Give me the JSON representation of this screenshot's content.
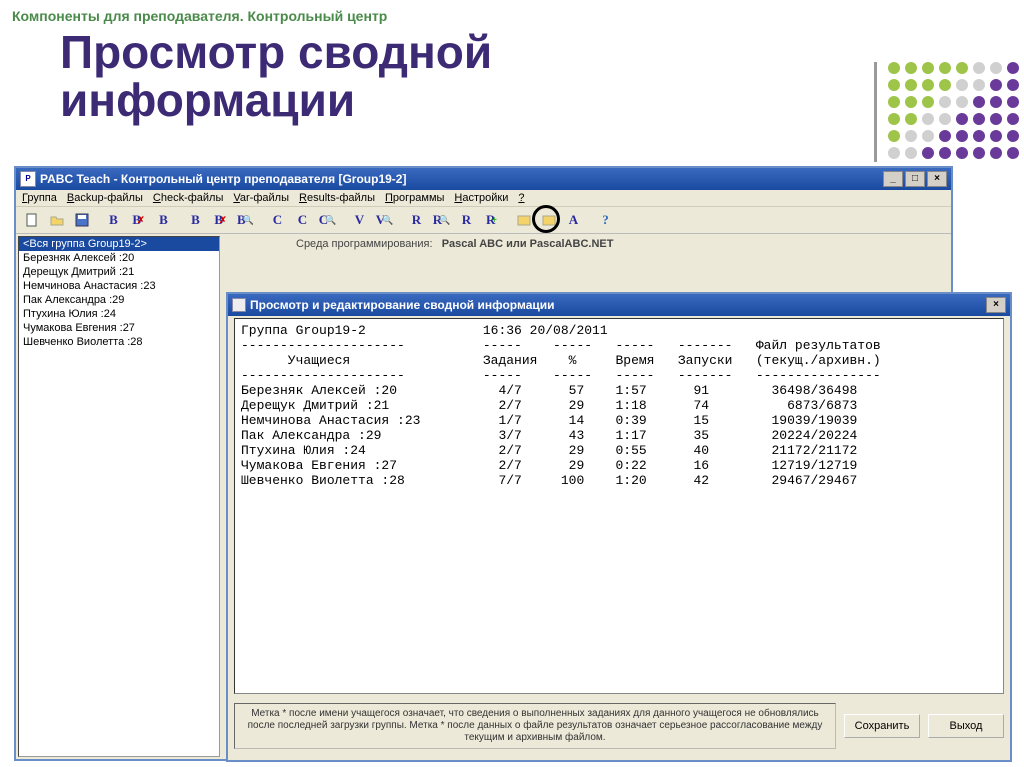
{
  "slide": {
    "breadcrumb": "Компоненты для преподавателя. Контрольный центр",
    "title_line1": "Просмотр сводной",
    "title_line2": "информации"
  },
  "mainWindow": {
    "title": "PABC Teach - Контрольный центр преподавателя [Group19-2]",
    "menu": [
      "Группа",
      "Backup-файлы",
      "Check-файлы",
      "Var-файлы",
      "Results-файлы",
      "Программы",
      "Настройки",
      "?"
    ],
    "toolbarIcons": [
      "new",
      "open",
      "save",
      "sep",
      "b-open",
      "b-export",
      "b-refresh",
      "sep",
      "B",
      "Bx",
      "Bsearch",
      "sep",
      "C",
      "Cc",
      "Csearch",
      "sep",
      "V",
      "Vsearch",
      "sep",
      "R",
      "Rsearch",
      "Rp",
      "Rplus",
      "sep",
      "g1",
      "g2",
      "A",
      "sep",
      "help"
    ],
    "envLabel": "Среда программирования:",
    "envValue": "Pascal ABC или PascalABC.NET",
    "sidebar": {
      "selected": "<Вся группа Group19-2>",
      "items": [
        "Березняк Алексей :20",
        "Дерещук Дмитрий :21",
        "Немчинова Анастасия :23",
        "Пак Александра :29",
        "Птухина Юлия :24",
        "Чумакова Евгения :27",
        "Шевченко Виолетта :28"
      ]
    }
  },
  "dialog": {
    "title": "Просмотр и редактирование сводной информации",
    "groupLine": "Группа Group19-2               16:36 20/08/2011",
    "dashes1": "---------------------          -----    -----   -----   -------   Файл результатов",
    "headers": "      Учащиеся                 Задания    %     Время   Запуски   (текущ./архивн.)",
    "dashes2": "---------------------          -----    -----   -----   -------   ----------------",
    "rows": [
      {
        "name": "Березняк Алексей :20",
        "tasks": "4/7",
        "pct": "57",
        "time": "1:57",
        "runs": "91",
        "files": "36498/36498"
      },
      {
        "name": "Дерещук Дмитрий :21",
        "tasks": "2/7",
        "pct": "29",
        "time": "1:18",
        "runs": "74",
        "files": "6873/6873"
      },
      {
        "name": "Немчинова Анастасия :23",
        "tasks": "1/7",
        "pct": "14",
        "time": "0:39",
        "runs": "15",
        "files": "19039/19039"
      },
      {
        "name": "Пак Александра :29",
        "tasks": "3/7",
        "pct": "43",
        "time": "1:17",
        "runs": "35",
        "files": "20224/20224"
      },
      {
        "name": "Птухина Юлия :24",
        "tasks": "2/7",
        "pct": "29",
        "time": "0:55",
        "runs": "40",
        "files": "21172/21172"
      },
      {
        "name": "Чумакова Евгения :27",
        "tasks": "2/7",
        "pct": "29",
        "time": "0:22",
        "runs": "16",
        "files": "12719/12719"
      },
      {
        "name": "Шевченко Виолетта :28",
        "tasks": "7/7",
        "pct": "100",
        "time": "1:20",
        "runs": "42",
        "files": "29467/29467"
      }
    ],
    "hint": "Метка * после имени учащегося означает, что сведения о выполненных заданиях для данного учащегося не обновлялись после последней загрузки группы. Метка * после данных о файле результатов означает серьезное рассогласование между текущим и архивным файлом.",
    "saveBtn": "Сохранить",
    "exitBtn": "Выход"
  },
  "dotColors": [
    "#9ec54a",
    "#9ec54a",
    "#9ec54a",
    "#9ec54a",
    "#9ec54a",
    "#d0d0d0",
    "#d0d0d0",
    "#6a3a9a",
    "#9ec54a",
    "#9ec54a",
    "#9ec54a",
    "#9ec54a",
    "#d0d0d0",
    "#d0d0d0",
    "#6a3a9a",
    "#6a3a9a",
    "#9ec54a",
    "#9ec54a",
    "#9ec54a",
    "#d0d0d0",
    "#d0d0d0",
    "#6a3a9a",
    "#6a3a9a",
    "#6a3a9a",
    "#9ec54a",
    "#9ec54a",
    "#d0d0d0",
    "#d0d0d0",
    "#6a3a9a",
    "#6a3a9a",
    "#6a3a9a",
    "#6a3a9a",
    "#9ec54a",
    "#d0d0d0",
    "#d0d0d0",
    "#6a3a9a",
    "#6a3a9a",
    "#6a3a9a",
    "#6a3a9a",
    "#6a3a9a",
    "#d0d0d0",
    "#d0d0d0",
    "#6a3a9a",
    "#6a3a9a",
    "#6a3a9a",
    "#6a3a9a",
    "#6a3a9a",
    "#6a3a9a"
  ]
}
